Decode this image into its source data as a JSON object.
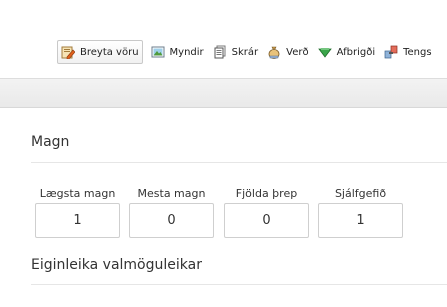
{
  "toolbar": {
    "items": [
      {
        "label": "Breyta vöru",
        "icon": "edit-product-icon",
        "active": true
      },
      {
        "label": "Myndir",
        "icon": "image-icon",
        "active": false
      },
      {
        "label": "Skrár",
        "icon": "files-icon",
        "active": false
      },
      {
        "label": "Verð",
        "icon": "money-bag-icon",
        "active": false
      },
      {
        "label": "Afbrigði",
        "icon": "variants-icon",
        "active": false
      },
      {
        "label": "Tengs",
        "icon": "related-icon",
        "active": false
      }
    ]
  },
  "quantity_section": {
    "title": "Magn",
    "fields": [
      {
        "label": "Lægsta magn",
        "value": "1"
      },
      {
        "label": "Mesta magn",
        "value": "0"
      },
      {
        "label": "Fjölda þrep",
        "value": "0"
      },
      {
        "label": "Sjálfgefið",
        "value": "1"
      }
    ]
  },
  "options_section": {
    "title": "Eiginleika valmöguleikar"
  },
  "colors": {
    "strip": "#ececec",
    "divider": "#e6e6e6",
    "input_border": "#cfcfcf",
    "text": "#333333"
  }
}
